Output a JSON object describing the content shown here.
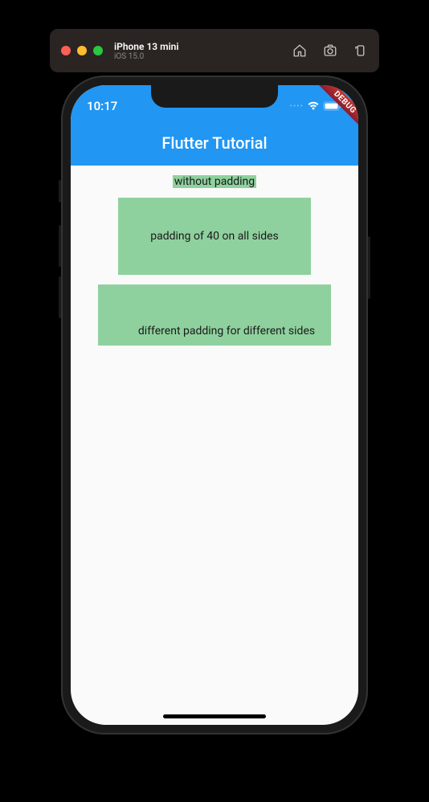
{
  "simulator": {
    "device_name": "iPhone 13 mini",
    "os_version": "iOS 15.0"
  },
  "status_bar": {
    "time": "10:17"
  },
  "app_bar": {
    "title": "Flutter Tutorial"
  },
  "debug_banner": {
    "label": "DEBUG"
  },
  "boxes": {
    "box1_text": "without padding",
    "box2_text": "padding of 40 on all sides",
    "box3_text": "different padding for different sides"
  },
  "colors": {
    "primary": "#2196f3",
    "box_bg": "#8fd19e"
  }
}
